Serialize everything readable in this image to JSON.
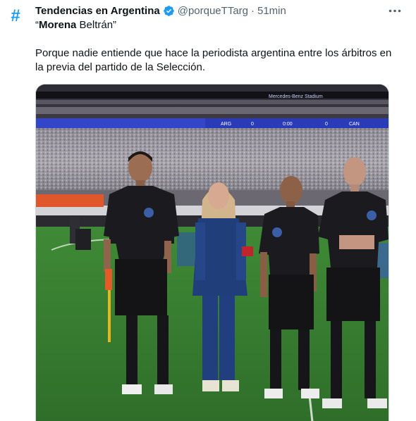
{
  "tweet": {
    "avatar_glyph": "#",
    "author_name": "Tendencias en Argentina",
    "handle": "@porqueTTarg",
    "separator": "·",
    "time": "51min",
    "quote_prefix": "“",
    "quote_bold": "Morena",
    "quote_rest": " Beltrán”",
    "text": "Porque nadie entiende que hace la periodista argentina entre los árbitros en la previa del partido de la Selección."
  },
  "icons": {
    "avatar": "hashtag-icon",
    "verified": "verified-badge-icon",
    "more": "more-options-icon"
  },
  "photo": {
    "stadium_sign": "Mercedes-Benz Stadium",
    "scoreboard": {
      "team_left": "ARG",
      "score_left": "0",
      "score_center": "0:00",
      "score_right": "0",
      "team_right": "CAN"
    }
  },
  "colors": {
    "accent": "#1d9bf0",
    "text_primary": "#0f1419",
    "text_secondary": "#536471",
    "border": "#cfd9de"
  }
}
